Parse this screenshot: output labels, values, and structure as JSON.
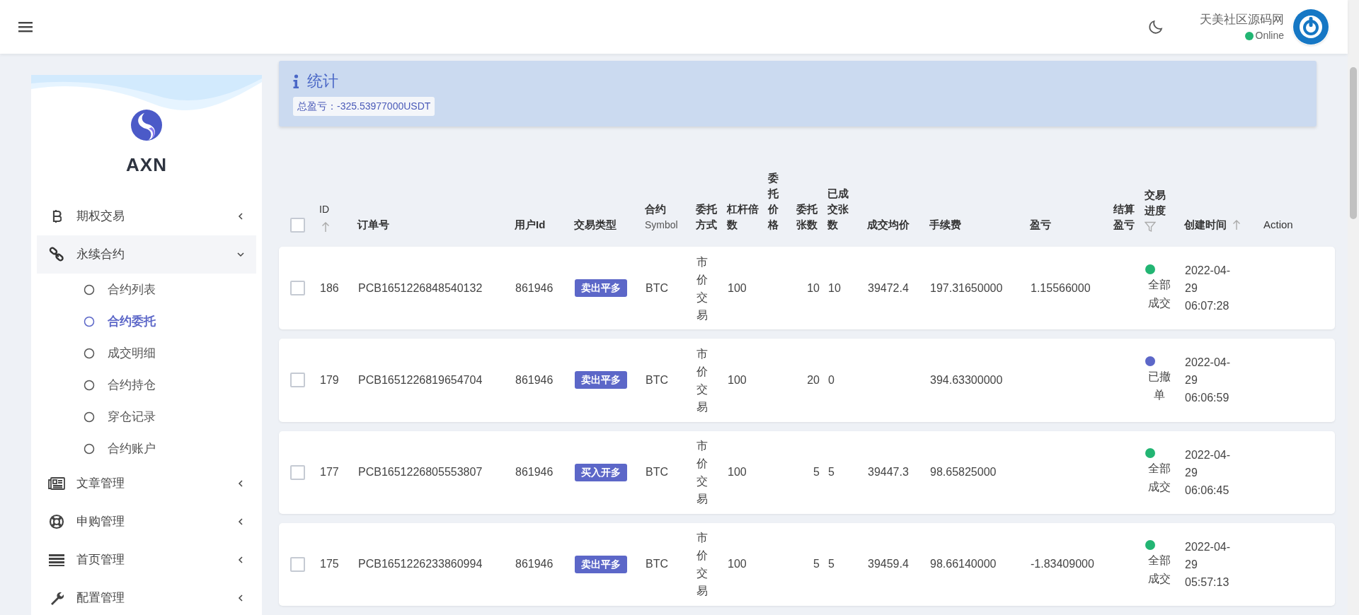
{
  "topbar": {
    "user_name": "天美社区源码网",
    "status": "Online"
  },
  "sidebar": {
    "brand": "AXN",
    "items": [
      {
        "label": "期权交易",
        "expanded": false
      },
      {
        "label": "永续合约",
        "expanded": true,
        "children": [
          {
            "label": "合约列表",
            "selected": false
          },
          {
            "label": "合约委托",
            "selected": true
          },
          {
            "label": "成交明细",
            "selected": false
          },
          {
            "label": "合约持仓",
            "selected": false
          },
          {
            "label": "穿仓记录",
            "selected": false
          },
          {
            "label": "合约账户",
            "selected": false
          }
        ]
      },
      {
        "label": "文章管理",
        "expanded": false
      },
      {
        "label": "申购管理",
        "expanded": false
      },
      {
        "label": "首页管理",
        "expanded": false
      },
      {
        "label": "配置管理",
        "expanded": false
      }
    ]
  },
  "stats": {
    "title": "统计",
    "total": "总盈亏：-325.53977000USDT"
  },
  "table": {
    "all_checked": false,
    "columns": [
      {
        "label": "ID",
        "kind": "sortable"
      },
      {
        "label": "订单号",
        "kind": "plain"
      },
      {
        "label": "用户Id",
        "kind": "plain"
      },
      {
        "label": "交易类型",
        "kind": "plain"
      },
      {
        "label": "合约",
        "sub": "Symbol",
        "kind": "plain"
      },
      {
        "label": "委托方式",
        "kind": "plain"
      },
      {
        "label": "杠杆倍数",
        "kind": "plain"
      },
      {
        "label": "委托价格",
        "kind": "plain"
      },
      {
        "label": "委托张数",
        "kind": "plain"
      },
      {
        "label": "已成交张数",
        "kind": "plain"
      },
      {
        "label": "成交均价",
        "kind": "plain"
      },
      {
        "label": "手续费",
        "kind": "plain"
      },
      {
        "label": "盈亏",
        "kind": "plain"
      },
      {
        "label": "结算盈亏",
        "kind": "plain"
      },
      {
        "label": "交易进度",
        "kind": "filter"
      },
      {
        "label": "创建时间",
        "kind": "sortable"
      },
      {
        "label": "Action",
        "kind": "action"
      }
    ],
    "rows": [
      {
        "checked": false,
        "id": "186",
        "order_no": "PCB1651226848540132",
        "user_id": "861946",
        "trade_type": "卖出平多",
        "symbol": "BTC",
        "order_mode": "市价交易",
        "leverage": "100",
        "order_qty": "10",
        "filled_qty": "10",
        "avg_price": "39472.4",
        "fee": "197.31650000",
        "pnl": "1.15566000",
        "progress": {
          "label": "全部成交",
          "color": "#22b573"
        },
        "created": "2022-04-29 06:07:28"
      },
      {
        "checked": false,
        "id": "179",
        "order_no": "PCB1651226819654704",
        "user_id": "861946",
        "trade_type": "卖出平多",
        "symbol": "BTC",
        "order_mode": "市价交易",
        "leverage": "100",
        "order_qty": "20",
        "filled_qty": "0",
        "fee": "394.63300000",
        "progress": {
          "label": "已撤单",
          "color": "#5c67c8"
        },
        "created": "2022-04-29 06:06:59"
      },
      {
        "checked": false,
        "id": "177",
        "order_no": "PCB1651226805553807",
        "user_id": "861946",
        "trade_type": "买入开多",
        "symbol": "BTC",
        "order_mode": "市价交易",
        "leverage": "100",
        "order_qty": "5",
        "filled_qty": "5",
        "avg_price": "39447.3",
        "fee": "98.65825000",
        "progress": {
          "label": "全部成交",
          "color": "#22b573"
        },
        "created": "2022-04-29 06:06:45"
      },
      {
        "checked": false,
        "id": "175",
        "order_no": "PCB1651226233860994",
        "user_id": "861946",
        "trade_type": "卖出平多",
        "symbol": "BTC",
        "order_mode": "市价交易",
        "leverage": "100",
        "order_qty": "5",
        "filled_qty": "5",
        "avg_price": "39459.4",
        "fee": "98.66140000",
        "pnl": "-1.83409000",
        "progress": {
          "label": "全部成交",
          "color": "#22b573"
        },
        "created": "2022-04-29 05:57:13"
      }
    ]
  }
}
